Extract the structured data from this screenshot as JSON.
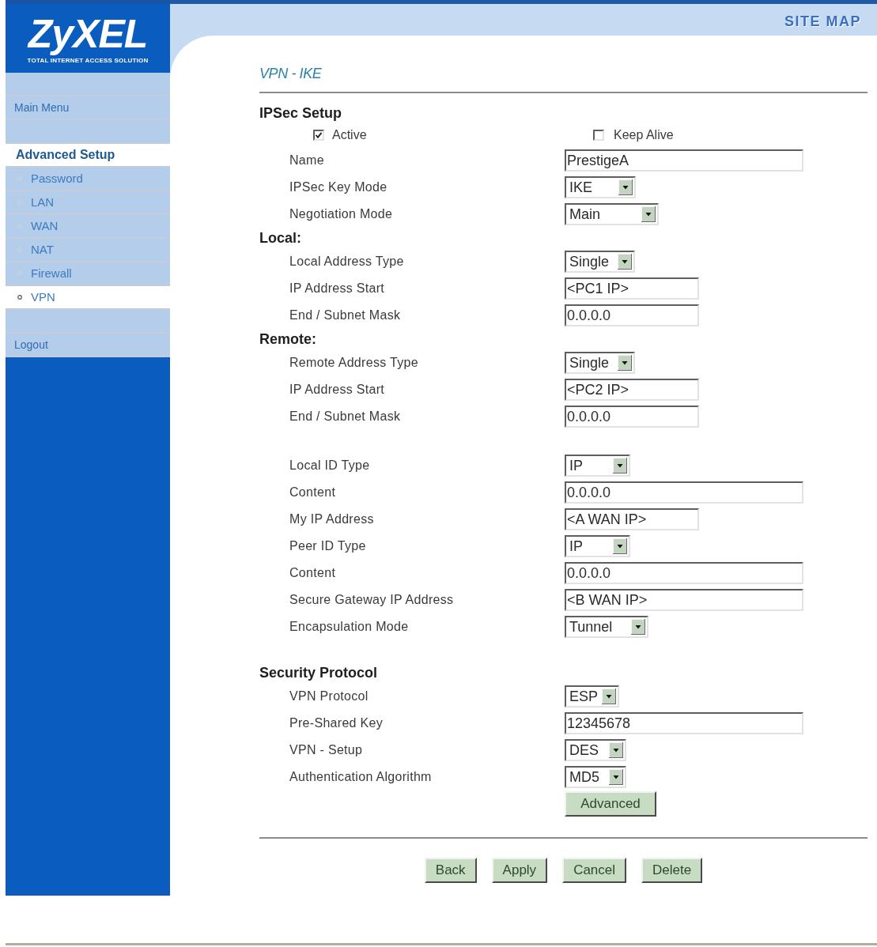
{
  "header": {
    "logo": "ZyXEL",
    "tagline": "TOTAL INTERNET ACCESS SOLUTION",
    "site_map": "SITE MAP"
  },
  "sidebar": {
    "groups": [
      {
        "items": [
          {
            "label": "Main Menu",
            "kind": "link",
            "selected": false
          }
        ]
      },
      {
        "items": [
          {
            "label": "Advanced Setup",
            "kind": "heading",
            "selected": true
          },
          {
            "label": "Password",
            "kind": "sub",
            "selected": false
          },
          {
            "label": "LAN",
            "kind": "sub",
            "selected": false
          },
          {
            "label": "WAN",
            "kind": "sub",
            "selected": false
          },
          {
            "label": "NAT",
            "kind": "sub",
            "selected": false
          },
          {
            "label": "Firewall",
            "kind": "sub",
            "selected": false
          },
          {
            "label": "VPN",
            "kind": "sub",
            "selected": true
          }
        ]
      },
      {
        "items": [
          {
            "label": "Logout",
            "kind": "link",
            "selected": false
          }
        ]
      }
    ]
  },
  "form": {
    "title": "VPN - IKE",
    "sections": [
      {
        "kind": "inline",
        "heading": "IPSec Setup",
        "rows": [
          {
            "kind": "checkboxes",
            "options": [
              {
                "label": "Active",
                "checked": true
              },
              {
                "label": "Keep Alive",
                "checked": false
              }
            ]
          },
          {
            "kind": "text",
            "label": "Name",
            "value": "PrestigeA"
          },
          {
            "kind": "select",
            "label": "IPSec Key Mode",
            "value": "IKE"
          },
          {
            "kind": "select",
            "label": "Negotiation Mode",
            "value": "Main"
          }
        ]
      },
      {
        "kind": "inline",
        "heading": "Local:",
        "rows": [
          {
            "kind": "select",
            "label": "Local Address Type",
            "value": "Single"
          },
          {
            "kind": "text",
            "label": "IP Address Start",
            "value": "<PC1 IP>"
          },
          {
            "kind": "text",
            "label": "End / Subnet Mask",
            "value": "0.0.0.0"
          }
        ]
      },
      {
        "kind": "inline",
        "heading": "Remote:",
        "rows": [
          {
            "kind": "select",
            "label": "Remote Address Type",
            "value": "Single"
          },
          {
            "kind": "text",
            "label": "IP Address Start",
            "value": "<PC2 IP>"
          },
          {
            "kind": "text",
            "label": "End / Subnet Mask",
            "value": "0.0.0.0"
          }
        ]
      },
      {
        "kind": "spaced",
        "rows": [
          {
            "kind": "select",
            "label": "Local ID Type",
            "value": "IP"
          },
          {
            "kind": "text",
            "label": "Content",
            "value": "0.0.0.0"
          },
          {
            "kind": "text",
            "label": "My IP Address",
            "value": "<A WAN IP>"
          },
          {
            "kind": "select",
            "label": "Peer ID Type",
            "value": "IP"
          },
          {
            "kind": "text",
            "label": "Content",
            "value": "0.0.0.0"
          },
          {
            "kind": "text",
            "label": "Secure Gateway IP Address",
            "value": "<B WAN IP>"
          },
          {
            "kind": "select",
            "label": "Encapsulation Mode",
            "value": "Tunnel"
          }
        ]
      },
      {
        "kind": "spaced",
        "heading": "Security Protocol",
        "rows": [
          {
            "kind": "select",
            "label": "VPN Protocol",
            "value": "ESP"
          },
          {
            "kind": "text",
            "label": "Pre-Shared Key",
            "value": "12345678"
          },
          {
            "kind": "select",
            "label": "VPN - Setup",
            "value": "DES"
          },
          {
            "kind": "select",
            "label": "Authentication Algorithm",
            "value": "MD5"
          },
          {
            "kind": "button",
            "label": "Advanced"
          }
        ]
      }
    ]
  },
  "actions": [
    {
      "label": "Back"
    },
    {
      "label": "Apply"
    },
    {
      "label": "Cancel"
    },
    {
      "label": "Delete"
    }
  ]
}
